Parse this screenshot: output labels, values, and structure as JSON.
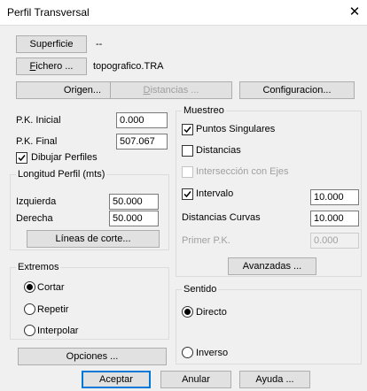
{
  "window": {
    "title": "Perfil Transversal"
  },
  "icons": {
    "close": "close-icon",
    "check": "checkmark-icon",
    "radio": "radio-dot-icon"
  },
  "top": {
    "superficie_button": "Superficie",
    "superficie_value": "--",
    "fichero_button_first": "F",
    "fichero_button_rest": "ichero ...",
    "fichero_value": "topografico.TRA",
    "origen_button": "Origen...",
    "distancias_button_first": "D",
    "distancias_button_rest": "istancias ...",
    "configuracion_button": "Configuracion..."
  },
  "left": {
    "pk_inicial_label": "P.K. Inicial",
    "pk_inicial_value": "0.000",
    "pk_final_label": "P.K. Final",
    "pk_final_value": "507.067",
    "dibujar_label": "Dibujar Perfiles",
    "dibujar_checked": true,
    "longitud_legend": "Longitud Perfil (mts)",
    "izquierda_label": "Izquierda",
    "izquierda_value": "50.000",
    "derecha_label": "Derecha",
    "derecha_value": "50.000",
    "lineas_button": "Líneas de corte...",
    "extremos_legend": "Extremos",
    "extremos_options": [
      "Cortar",
      "Repetir",
      "Interpolar"
    ],
    "opciones_button": "Opciones ..."
  },
  "muestreo": {
    "legend": "Muestreo",
    "puntos_label": "Puntos Singulares",
    "puntos_checked": true,
    "distancias_label": "Distancias",
    "distancias_checked": false,
    "interseccion_label": "Intersección con Ejes",
    "interseccion_checked": false,
    "intervalo_label": "Intervalo",
    "intervalo_checked": true,
    "intervalo_value": "10.000",
    "dist_curvas_label": "Distancias Curvas",
    "dist_curvas_value": "10.000",
    "primer_pk_label": "Primer P.K.",
    "primer_pk_value": "0.000",
    "avanzadas_button": "Avanzadas ..."
  },
  "sentido": {
    "legend": "Sentido",
    "directo_label": "Directo",
    "inverso_label": "Inverso",
    "selected": "Directo"
  },
  "footer": {
    "aceptar_button": "Aceptar",
    "anular_button": "Anular",
    "ayuda_button": "Ayuda ..."
  },
  "colors": {
    "focus": "#0078d7",
    "disabled_text": "#a0a0a0",
    "background": "#f0f0f0"
  }
}
